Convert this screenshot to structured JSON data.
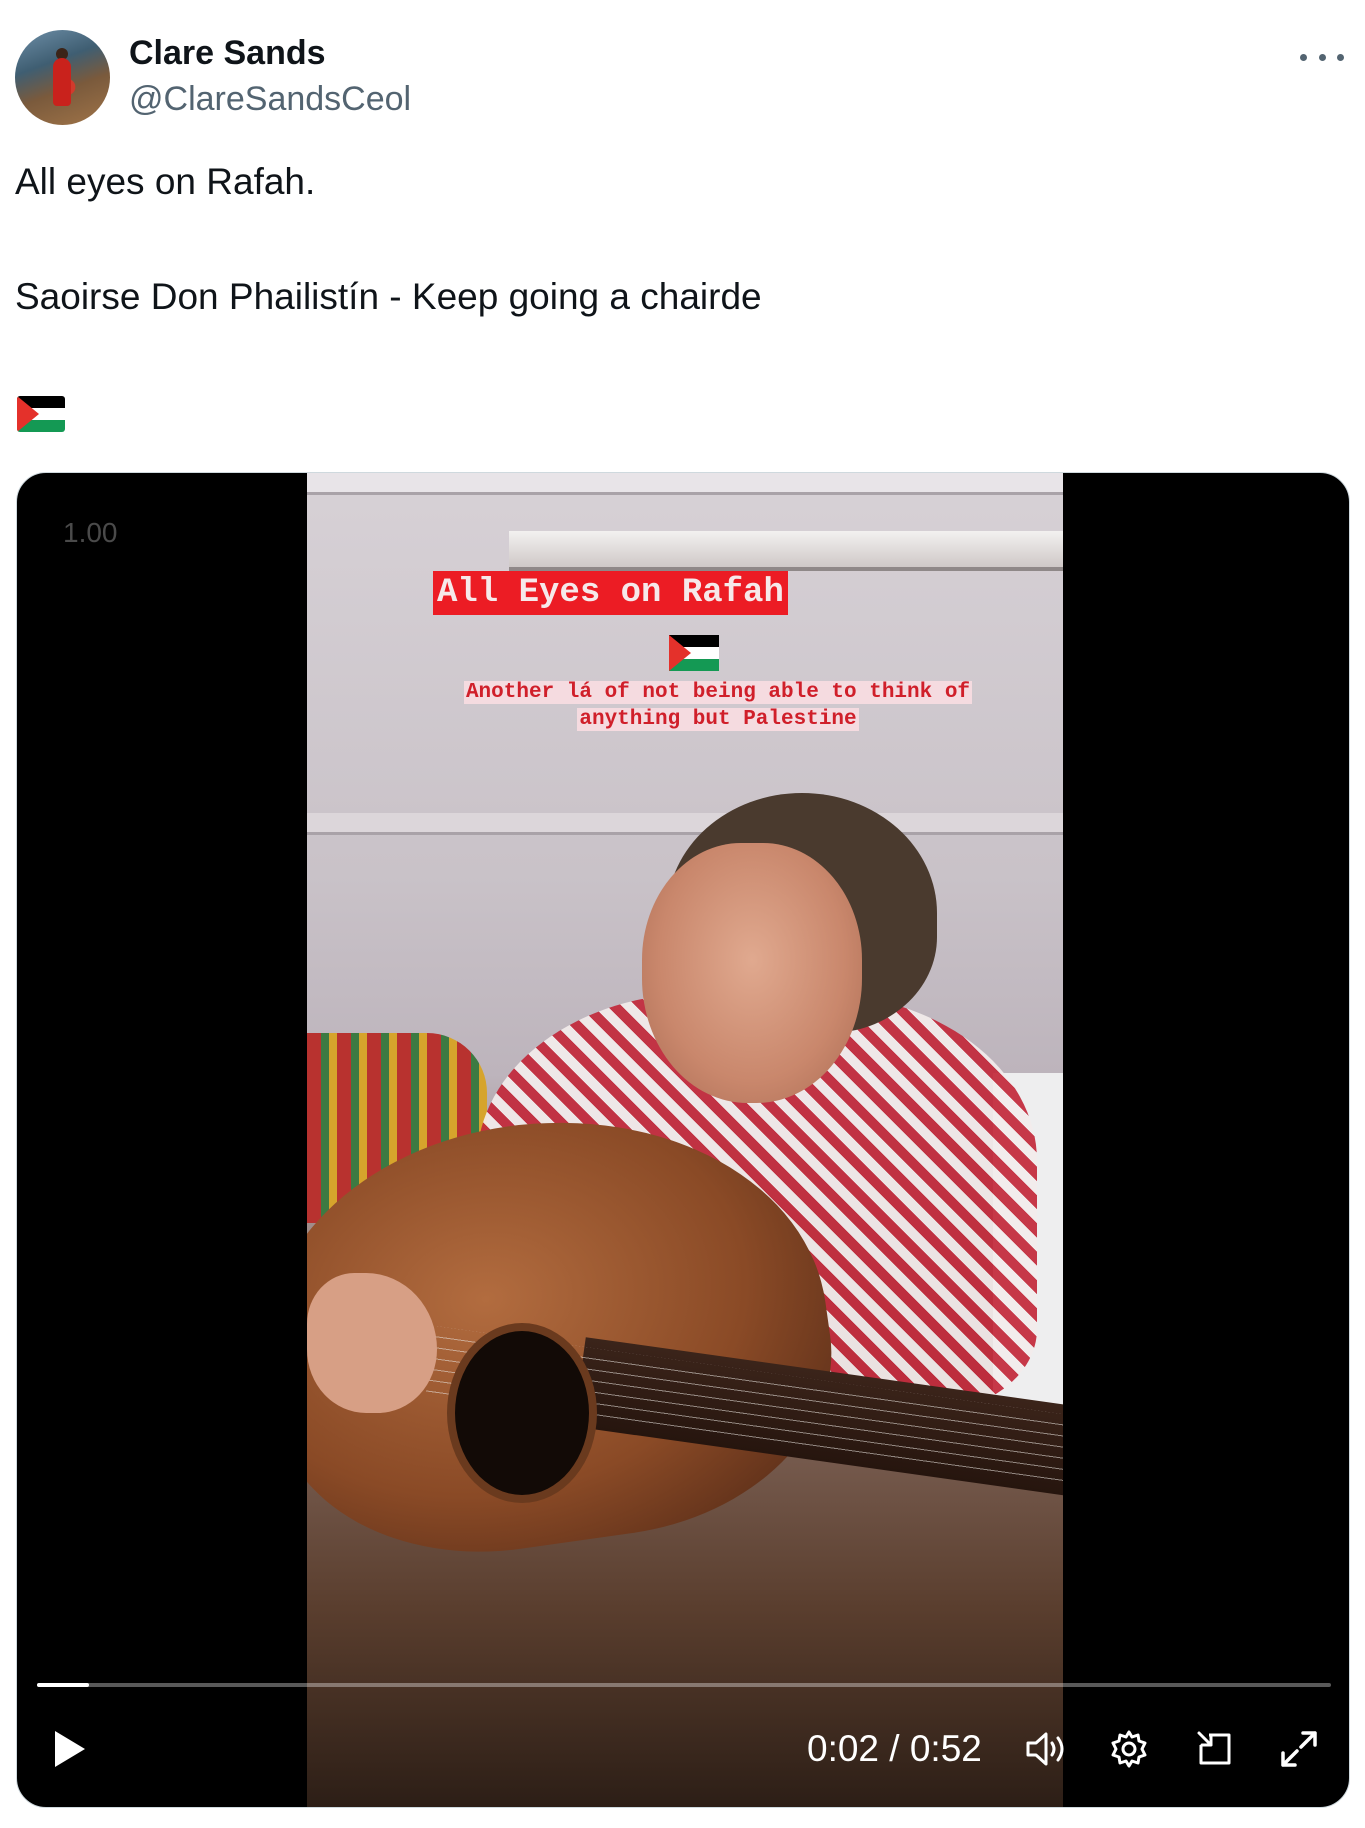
{
  "author": {
    "name": "Clare Sands",
    "handle": "@ClareSandsCeol",
    "avatar_icon": "avatar-photo"
  },
  "more_icon": "more-horizontal-icon",
  "tweet": {
    "line1": "All eyes on Rafah.",
    "line2": "Saoirse Don Phailistín - Keep going a chairde",
    "emoji": "palestine-flag-emoji"
  },
  "video": {
    "speed_label": "1.00",
    "overlay_title": "All Eyes on Rafah",
    "overlay_sub_line1": "Another lá of not being able to think of",
    "overlay_sub_line2": "anything but Palestine",
    "progress": 0.04,
    "time": "0:02 / 0:52",
    "controls": {
      "play_icon": "play-icon",
      "volume_icon": "volume-icon",
      "settings_icon": "gear-icon",
      "pip_icon": "picture-in-picture-icon",
      "fullscreen_icon": "fullscreen-icon"
    }
  },
  "colors": {
    "text": "#0f1419",
    "secondary": "#536471",
    "caption_red": "#ec1c24",
    "flag_black": "#000000",
    "flag_white": "#ffffff",
    "flag_green": "#149954",
    "flag_red": "#e4312b"
  }
}
